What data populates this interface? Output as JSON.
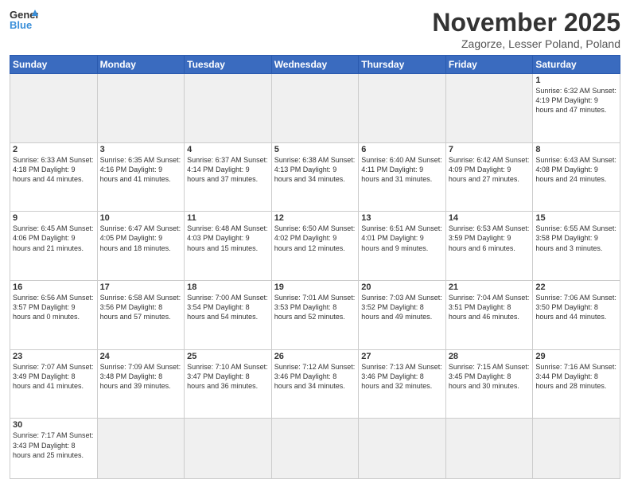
{
  "logo": {
    "text_general": "General",
    "text_blue": "Blue"
  },
  "header": {
    "title": "November 2025",
    "location": "Zagorze, Lesser Poland, Poland"
  },
  "days_of_week": [
    "Sunday",
    "Monday",
    "Tuesday",
    "Wednesday",
    "Thursday",
    "Friday",
    "Saturday"
  ],
  "weeks": [
    [
      {
        "day": "",
        "info": ""
      },
      {
        "day": "",
        "info": ""
      },
      {
        "day": "",
        "info": ""
      },
      {
        "day": "",
        "info": ""
      },
      {
        "day": "",
        "info": ""
      },
      {
        "day": "",
        "info": ""
      },
      {
        "day": "1",
        "info": "Sunrise: 6:32 AM\nSunset: 4:19 PM\nDaylight: 9 hours and 47 minutes."
      }
    ],
    [
      {
        "day": "2",
        "info": "Sunrise: 6:33 AM\nSunset: 4:18 PM\nDaylight: 9 hours and 44 minutes."
      },
      {
        "day": "3",
        "info": "Sunrise: 6:35 AM\nSunset: 4:16 PM\nDaylight: 9 hours and 41 minutes."
      },
      {
        "day": "4",
        "info": "Sunrise: 6:37 AM\nSunset: 4:14 PM\nDaylight: 9 hours and 37 minutes."
      },
      {
        "day": "5",
        "info": "Sunrise: 6:38 AM\nSunset: 4:13 PM\nDaylight: 9 hours and 34 minutes."
      },
      {
        "day": "6",
        "info": "Sunrise: 6:40 AM\nSunset: 4:11 PM\nDaylight: 9 hours and 31 minutes."
      },
      {
        "day": "7",
        "info": "Sunrise: 6:42 AM\nSunset: 4:09 PM\nDaylight: 9 hours and 27 minutes."
      },
      {
        "day": "8",
        "info": "Sunrise: 6:43 AM\nSunset: 4:08 PM\nDaylight: 9 hours and 24 minutes."
      }
    ],
    [
      {
        "day": "9",
        "info": "Sunrise: 6:45 AM\nSunset: 4:06 PM\nDaylight: 9 hours and 21 minutes."
      },
      {
        "day": "10",
        "info": "Sunrise: 6:47 AM\nSunset: 4:05 PM\nDaylight: 9 hours and 18 minutes."
      },
      {
        "day": "11",
        "info": "Sunrise: 6:48 AM\nSunset: 4:03 PM\nDaylight: 9 hours and 15 minutes."
      },
      {
        "day": "12",
        "info": "Sunrise: 6:50 AM\nSunset: 4:02 PM\nDaylight: 9 hours and 12 minutes."
      },
      {
        "day": "13",
        "info": "Sunrise: 6:51 AM\nSunset: 4:01 PM\nDaylight: 9 hours and 9 minutes."
      },
      {
        "day": "14",
        "info": "Sunrise: 6:53 AM\nSunset: 3:59 PM\nDaylight: 9 hours and 6 minutes."
      },
      {
        "day": "15",
        "info": "Sunrise: 6:55 AM\nSunset: 3:58 PM\nDaylight: 9 hours and 3 minutes."
      }
    ],
    [
      {
        "day": "16",
        "info": "Sunrise: 6:56 AM\nSunset: 3:57 PM\nDaylight: 9 hours and 0 minutes."
      },
      {
        "day": "17",
        "info": "Sunrise: 6:58 AM\nSunset: 3:56 PM\nDaylight: 8 hours and 57 minutes."
      },
      {
        "day": "18",
        "info": "Sunrise: 7:00 AM\nSunset: 3:54 PM\nDaylight: 8 hours and 54 minutes."
      },
      {
        "day": "19",
        "info": "Sunrise: 7:01 AM\nSunset: 3:53 PM\nDaylight: 8 hours and 52 minutes."
      },
      {
        "day": "20",
        "info": "Sunrise: 7:03 AM\nSunset: 3:52 PM\nDaylight: 8 hours and 49 minutes."
      },
      {
        "day": "21",
        "info": "Sunrise: 7:04 AM\nSunset: 3:51 PM\nDaylight: 8 hours and 46 minutes."
      },
      {
        "day": "22",
        "info": "Sunrise: 7:06 AM\nSunset: 3:50 PM\nDaylight: 8 hours and 44 minutes."
      }
    ],
    [
      {
        "day": "23",
        "info": "Sunrise: 7:07 AM\nSunset: 3:49 PM\nDaylight: 8 hours and 41 minutes."
      },
      {
        "day": "24",
        "info": "Sunrise: 7:09 AM\nSunset: 3:48 PM\nDaylight: 8 hours and 39 minutes."
      },
      {
        "day": "25",
        "info": "Sunrise: 7:10 AM\nSunset: 3:47 PM\nDaylight: 8 hours and 36 minutes."
      },
      {
        "day": "26",
        "info": "Sunrise: 7:12 AM\nSunset: 3:46 PM\nDaylight: 8 hours and 34 minutes."
      },
      {
        "day": "27",
        "info": "Sunrise: 7:13 AM\nSunset: 3:46 PM\nDaylight: 8 hours and 32 minutes."
      },
      {
        "day": "28",
        "info": "Sunrise: 7:15 AM\nSunset: 3:45 PM\nDaylight: 8 hours and 30 minutes."
      },
      {
        "day": "29",
        "info": "Sunrise: 7:16 AM\nSunset: 3:44 PM\nDaylight: 8 hours and 28 minutes."
      }
    ],
    [
      {
        "day": "30",
        "info": "Sunrise: 7:17 AM\nSunset: 3:43 PM\nDaylight: 8 hours and 25 minutes."
      },
      {
        "day": "",
        "info": ""
      },
      {
        "day": "",
        "info": ""
      },
      {
        "day": "",
        "info": ""
      },
      {
        "day": "",
        "info": ""
      },
      {
        "day": "",
        "info": ""
      },
      {
        "day": "",
        "info": ""
      }
    ]
  ]
}
